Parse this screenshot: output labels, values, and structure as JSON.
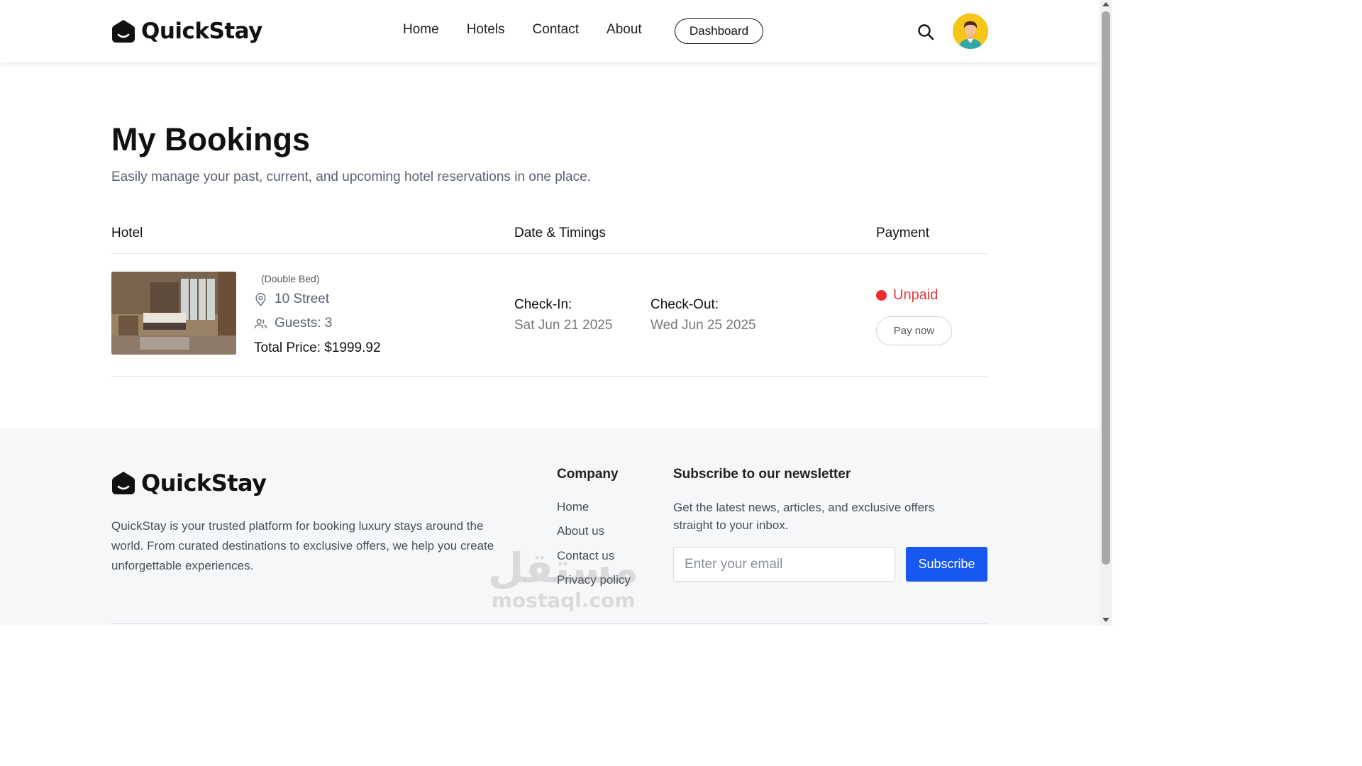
{
  "brand": {
    "name": "QuickStay"
  },
  "nav": {
    "items": [
      "Home",
      "Hotels",
      "Contact",
      "About"
    ],
    "dashboard_label": "Dashboard"
  },
  "page": {
    "title": "My Bookings",
    "subtitle": "Easily manage your past, current, and upcoming hotel reservations in one place."
  },
  "table": {
    "headers": [
      "Hotel",
      "Date & Timings",
      "Payment"
    ]
  },
  "booking": {
    "room_type": "(Double Bed)",
    "address": "10 Street",
    "guests": "Guests: 3",
    "total": "Total Price: $1999.92",
    "checkin_label": "Check-In:",
    "checkin_date": "Sat Jun 21 2025",
    "checkout_label": "Check-Out:",
    "checkout_date": "Wed Jun 25 2025",
    "status": "Unpaid",
    "status_color": "#ef2b2d",
    "pay_label": "Pay now"
  },
  "footer": {
    "description": "QuickStay is your trusted platform for booking luxury stays around the world. From curated destinations to exclusive offers, we help you create unforgettable experiences.",
    "company_title": "Company",
    "company_links": [
      "Home",
      "About us",
      "Contact us",
      "Privacy policy"
    ],
    "newsletter_title": "Subscribe to our newsletter",
    "newsletter_desc": "Get the latest news, articles, and exclusive offers straight to your inbox.",
    "email_placeholder": "Enter your email",
    "subscribe_label": "Subscribe",
    "accent_color": "#1758f0"
  },
  "watermark": {
    "arabic": "مستقل",
    "latin": "mostaql.com"
  },
  "icons": {
    "search": "search-icon",
    "location": "location-pin-icon",
    "guests": "users-icon",
    "avatar": "user-avatar-icon"
  }
}
